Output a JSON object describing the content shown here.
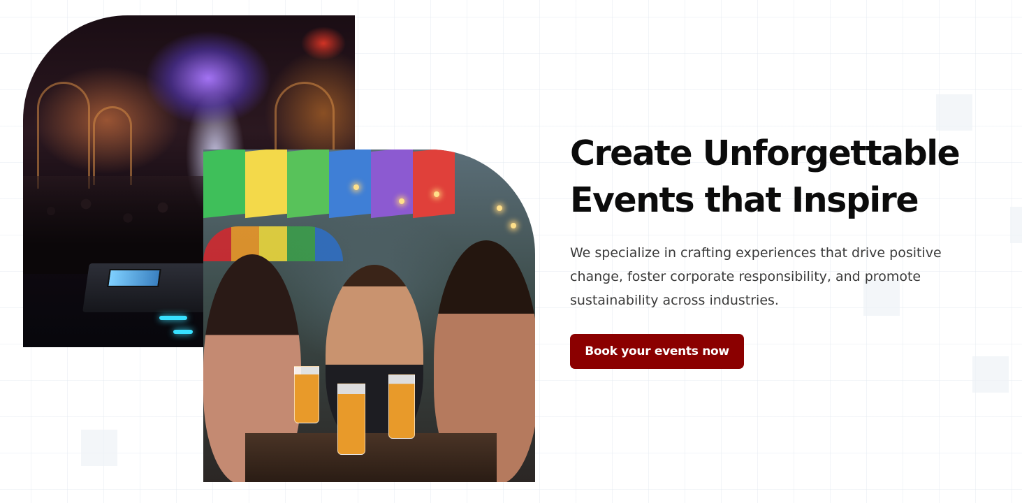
{
  "hero": {
    "title_line1": "Create Unforgettable",
    "title_line2": "Events that Inspire",
    "description": "We specialize in crafting experiences that drive positive change, foster corporate responsibility, and promote sustainability across industries.",
    "cta_label": "Book your events now"
  },
  "images": {
    "concert": "concert hall with DJ console and crowd under colorful lights",
    "festival": "friends sharing drinks at an outdoor festival under rainbow flags"
  },
  "colors": {
    "accent": "#8b0000",
    "title_text": "#0b0b0b",
    "body_text": "#3a3a3a",
    "background": "#ffffff",
    "grid": "#e2e8f0"
  }
}
